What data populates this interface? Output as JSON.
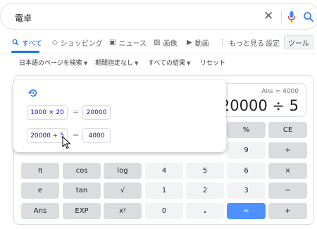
{
  "search": {
    "query": "電卓"
  },
  "tabs": [
    {
      "label": "すべて",
      "icon": "search-icon",
      "active": true
    },
    {
      "label": "ショッピング",
      "icon": "tag-icon"
    },
    {
      "label": "ニュース",
      "icon": "newspaper-icon"
    },
    {
      "label": "画像",
      "icon": "image-icon"
    },
    {
      "label": "動画",
      "icon": "play-icon"
    },
    {
      "label": "もっと見る",
      "icon": "more-vert-icon"
    }
  ],
  "settings_label": "設定",
  "tools_label": "ツール",
  "filters": [
    {
      "label": "日本語のページを検索",
      "has_caret": true
    },
    {
      "label": "期間指定なし",
      "has_caret": true
    },
    {
      "label": "すべての結果",
      "has_caret": true
    },
    {
      "label": "リセット",
      "has_caret": false
    }
  ],
  "calculator": {
    "ans_text": "Ans = 4000",
    "display": "20000 ÷ 5",
    "keys": {
      "percent": "%",
      "ce": "CE",
      "k9": "9",
      "div": "÷",
      "pi": "π",
      "cos": "cos",
      "log": "log",
      "k4": "4",
      "k5": "5",
      "k6": "6",
      "mul": "×",
      "e": "e",
      "tan": "tan",
      "sqrt": "√",
      "k1": "1",
      "k2": "2",
      "k3": "3",
      "minus": "−",
      "ans": "Ans",
      "exp": "EXP",
      "pow": "xʸ",
      "k0": "0",
      "dot": ".",
      "eq": "=",
      "plus": "+"
    }
  },
  "history": [
    {
      "expression": "1000 × 20",
      "equals": "=",
      "result": "20000"
    },
    {
      "expression": "20000 ÷ 5",
      "equals": "=",
      "result": "4000"
    }
  ],
  "colors": {
    "accent": "#1a73e8",
    "equals_key": "#4d90fe",
    "fn_key": "#dadce0",
    "num_key": "#f1f3f4"
  }
}
